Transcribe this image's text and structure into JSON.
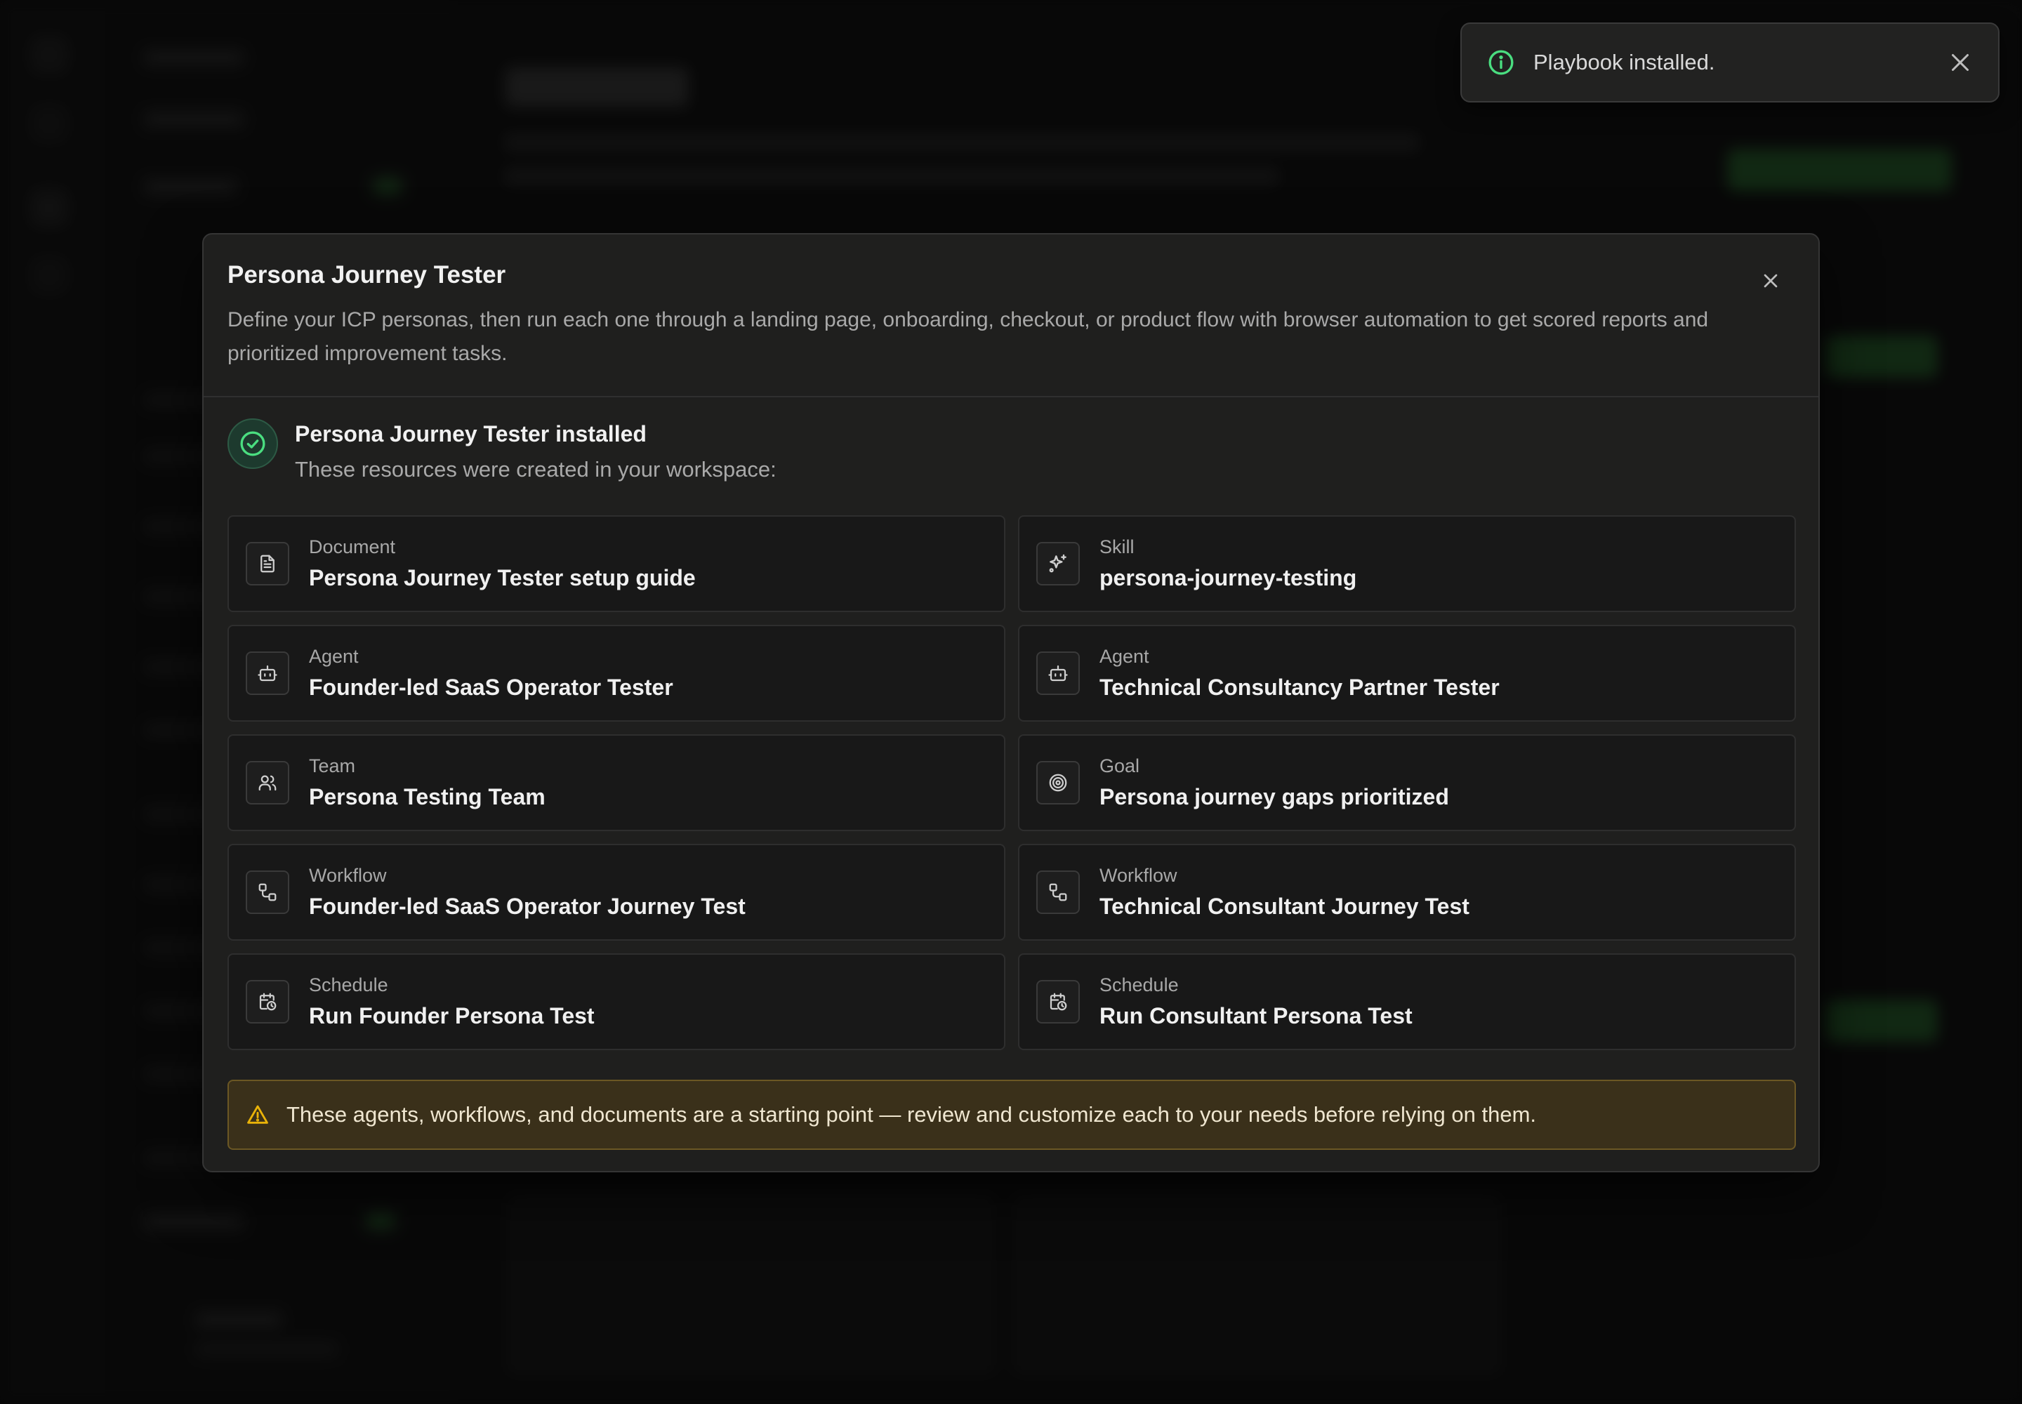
{
  "toast": {
    "message": "Playbook installed.",
    "info_icon": "info-icon",
    "close_icon": "close-icon"
  },
  "modal": {
    "title": "Persona Journey Tester",
    "description": "Define your ICP personas, then run each one through a landing page, onboarding, checkout, or product flow with browser automation to get scored reports and prioritized improvement tasks.",
    "close_icon": "close-icon",
    "installed": {
      "title": "Persona Journey Tester installed",
      "subtitle": "These resources were created in your workspace:",
      "icon": "check-circle-icon"
    },
    "resources": [
      {
        "type": "Document",
        "name": "Persona Journey Tester setup guide",
        "icon": "document-icon"
      },
      {
        "type": "Skill",
        "name": "persona-journey-testing",
        "icon": "sparkles-icon"
      },
      {
        "type": "Agent",
        "name": "Founder-led SaaS Operator Tester",
        "icon": "bot-icon"
      },
      {
        "type": "Agent",
        "name": "Technical Consultancy Partner Tester",
        "icon": "bot-icon"
      },
      {
        "type": "Team",
        "name": "Persona Testing Team",
        "icon": "users-icon"
      },
      {
        "type": "Goal",
        "name": "Persona journey gaps prioritized",
        "icon": "target-icon"
      },
      {
        "type": "Workflow",
        "name": "Founder-led SaaS Operator Journey Test",
        "icon": "workflow-icon"
      },
      {
        "type": "Workflow",
        "name": "Technical Consultant Journey Test",
        "icon": "workflow-icon"
      },
      {
        "type": "Schedule",
        "name": "Run Founder Persona Test",
        "icon": "calendar-clock-icon"
      },
      {
        "type": "Schedule",
        "name": "Run Consultant Persona Test",
        "icon": "calendar-clock-icon"
      }
    ],
    "warning": {
      "text": "These agents, workflows, and documents are a starting point — review and customize each to your needs before relying on them.",
      "icon": "warning-triangle-icon"
    }
  },
  "colors": {
    "accent_green": "#4ade80",
    "warning_bg": "#3a301a",
    "warning_border": "#6b5724",
    "warning_icon": "#eab308"
  }
}
